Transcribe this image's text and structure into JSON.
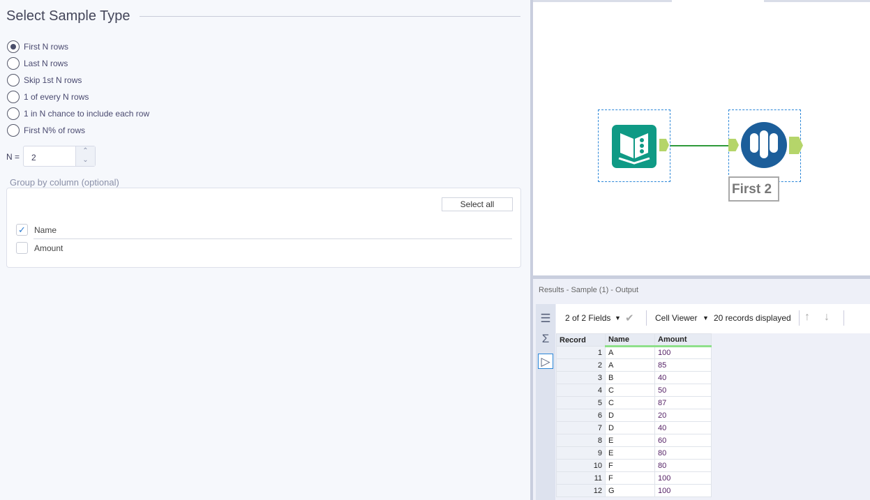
{
  "config": {
    "title": "Select Sample Type",
    "options": [
      "First N rows",
      "Last N rows",
      "Skip 1st N rows",
      "1 of every N rows",
      "1 in N chance to include each row",
      "First N% of rows"
    ],
    "selected": 0,
    "n_label": "N =",
    "n_value": "2",
    "group_label": "Group by column (optional)",
    "select_all": "Select all",
    "columns": [
      {
        "name": "Name",
        "checked": true
      },
      {
        "name": "Amount",
        "checked": false
      }
    ]
  },
  "canvas": {
    "tool_label": "First 2"
  },
  "results": {
    "title": "Results - Sample (1) - Output",
    "fields": "2 of 2 Fields",
    "viewer": "Cell Viewer",
    "records": "20 records displayed",
    "headers": [
      "Record",
      "Name",
      "Amount"
    ],
    "rows": [
      [
        "1",
        "A",
        "100"
      ],
      [
        "2",
        "A",
        "85"
      ],
      [
        "3",
        "B",
        "40"
      ],
      [
        "4",
        "C",
        "50"
      ],
      [
        "5",
        "C",
        "87"
      ],
      [
        "6",
        "D",
        "20"
      ],
      [
        "7",
        "D",
        "40"
      ],
      [
        "8",
        "E",
        "60"
      ],
      [
        "9",
        "E",
        "80"
      ],
      [
        "10",
        "F",
        "80"
      ],
      [
        "11",
        "F",
        "100"
      ],
      [
        "12",
        "G",
        "100"
      ]
    ]
  }
}
